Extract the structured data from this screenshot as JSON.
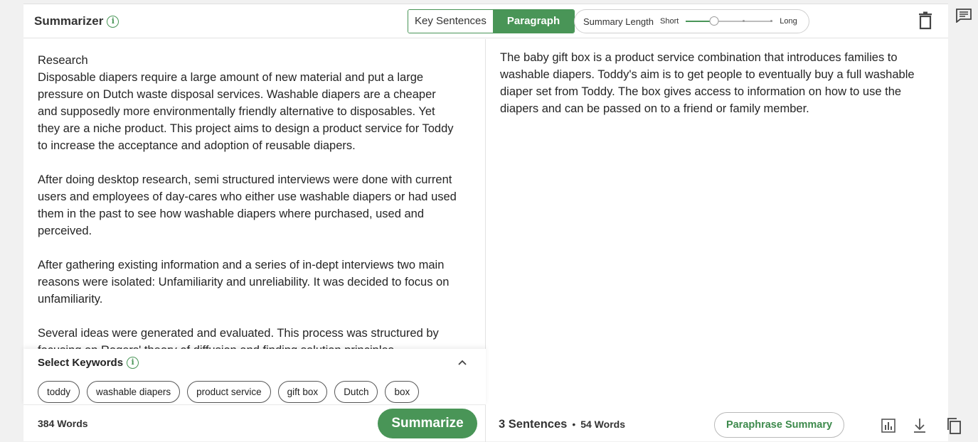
{
  "header": {
    "title": "Summarizer",
    "modes": [
      "Key Sentences",
      "Paragraph"
    ],
    "active_mode": "Paragraph",
    "length_label": "Summary Length",
    "length_min": "Short",
    "length_max": "Long",
    "length_value": 0.33
  },
  "input": {
    "text": "Research\nDisposable diapers require a large amount of new material and put a large pressure on Dutch waste disposal services. Washable diapers are a cheaper and supposedly more environmentally friendly alternative to disposables. Yet they are a niche product. This project aims to design a product service for Toddy to increase the acceptance and adoption of reusable diapers.\n\nAfter doing desktop research, semi structured interviews were done with current users and employees of day-cares who either use washable diapers or had used them in the past to see how washable diapers where purchased, used and perceived.\n\nAfter gathering existing information and a series of in-dept interviews two main reasons were isolated: Unfamiliarity and unreliability. It was decided to focus on unfamiliarity.\n\nSeveral ideas were generated and evaluated. This process was structured by focusing on Rogers' theory of diffusion and finding solution principles",
    "word_count": "384 Words"
  },
  "keywords": {
    "title": "Select Keywords",
    "items": [
      "toddy",
      "washable diapers",
      "product service",
      "gift box",
      "Dutch",
      "box"
    ]
  },
  "actions": {
    "summarize": "Summarize",
    "paraphrase": "Paraphrase Summary"
  },
  "output": {
    "text": "The baby gift box is a product service combination that introduces families to washable diapers. Toddy's aim is to get people to eventually buy a full washable diaper set from Toddy. The box gives access to information on how to use the diapers and can be passed on to a friend or family member.",
    "sentences": "3 Sentences",
    "words": "54 Words"
  },
  "colors": {
    "accent": "#499557",
    "accent_text": "#3d8a4c",
    "page_bg": "#f1f1f1"
  },
  "icons": [
    "info-icon",
    "trash-icon",
    "chevron-up-icon",
    "chart-icon",
    "download-icon",
    "copy-icon",
    "feedback-icon"
  ]
}
